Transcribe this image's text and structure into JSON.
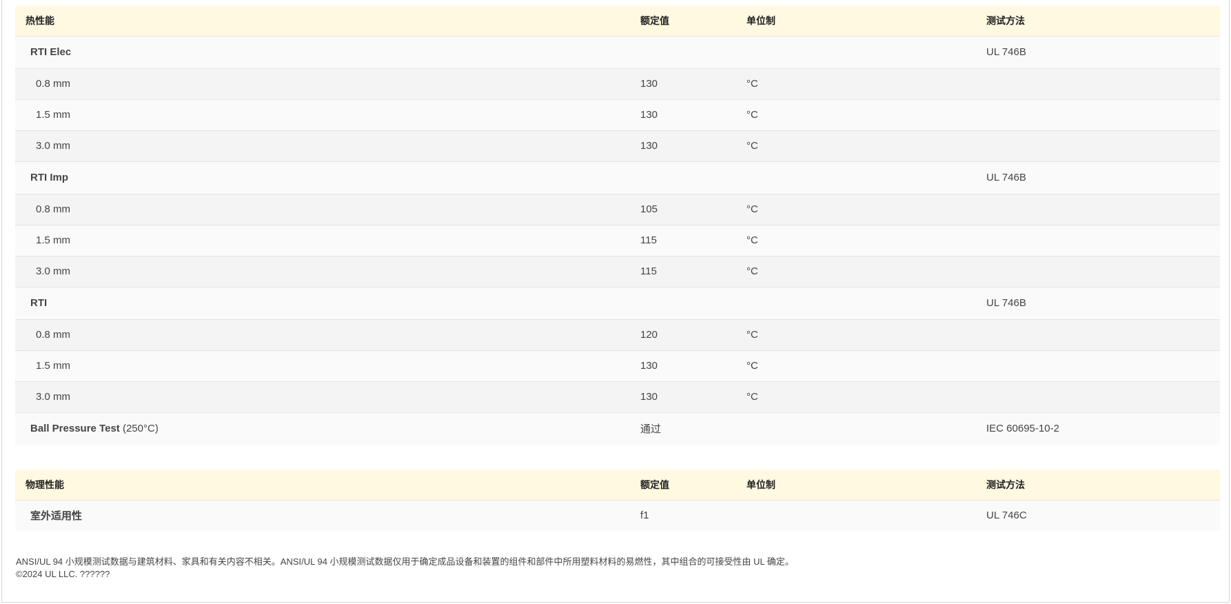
{
  "thermal": {
    "headers": {
      "name": "热性能",
      "value": "额定值",
      "unit": "单位制",
      "method": "测试方法"
    },
    "rti_elec": {
      "label": "RTI Elec",
      "method": "UL 746B",
      "rows": [
        {
          "thickness": "0.8 mm",
          "value": "130",
          "unit": "°C"
        },
        {
          "thickness": "1.5 mm",
          "value": "130",
          "unit": "°C"
        },
        {
          "thickness": "3.0 mm",
          "value": "130",
          "unit": "°C"
        }
      ]
    },
    "rti_imp": {
      "label": "RTI Imp",
      "method": "UL 746B",
      "rows": [
        {
          "thickness": "0.8 mm",
          "value": "105",
          "unit": "°C"
        },
        {
          "thickness": "1.5 mm",
          "value": "115",
          "unit": "°C"
        },
        {
          "thickness": "3.0 mm",
          "value": "115",
          "unit": "°C"
        }
      ]
    },
    "rti": {
      "label": "RTI",
      "method": "UL 746B",
      "rows": [
        {
          "thickness": "0.8 mm",
          "value": "120",
          "unit": "°C"
        },
        {
          "thickness": "1.5 mm",
          "value": "130",
          "unit": "°C"
        },
        {
          "thickness": "3.0 mm",
          "value": "130",
          "unit": "°C"
        }
      ]
    },
    "ball_pressure": {
      "label": "Ball Pressure Test",
      "condition": "(250°C)",
      "value": "通过",
      "method": "IEC 60695-10-2"
    }
  },
  "physical": {
    "headers": {
      "name": "物理性能",
      "value": "额定值",
      "unit": "单位制",
      "method": "测试方法"
    },
    "outdoor": {
      "label": "室外适用性",
      "value": "f1",
      "method": "UL 746C"
    }
  },
  "footer": {
    "disclaimer": "ANSI/UL 94 小规模测试数据与建筑材料、家具和有关内容不相关。ANSI/UL 94 小规模测试数据仅用于确定成品设备和装置的组件和部件中所用塑料材料的易燃性，其中组合的可接受性由 UL 确定。",
    "copyright": "©2024 UL LLC. ??????"
  }
}
